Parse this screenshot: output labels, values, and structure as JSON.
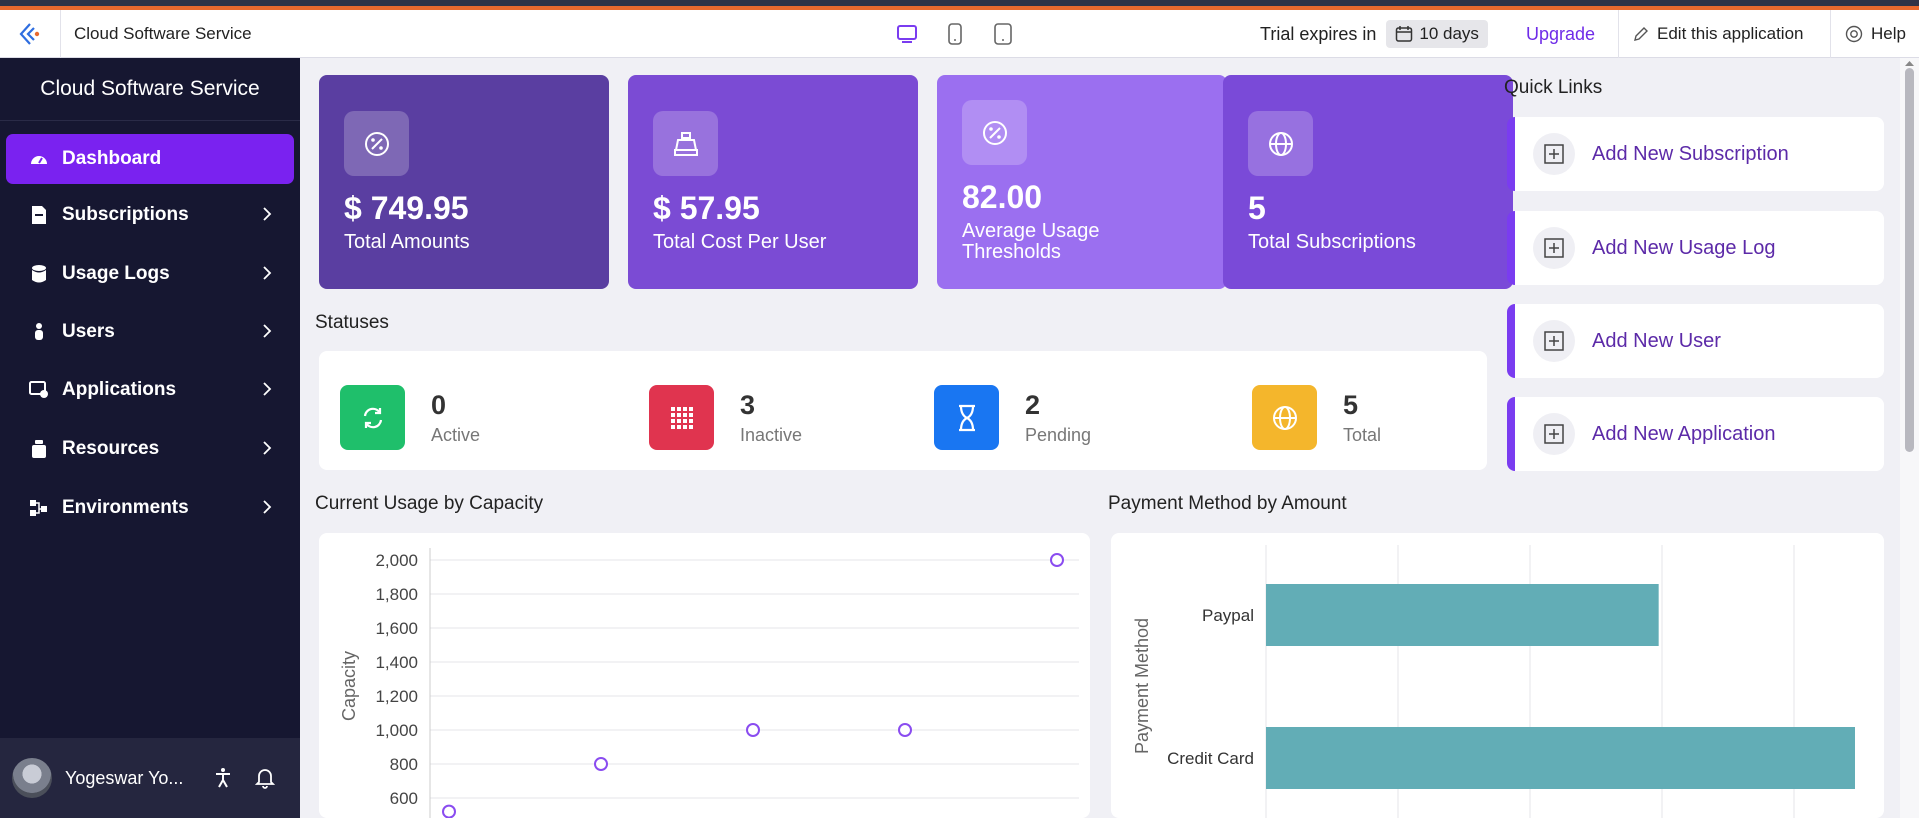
{
  "topbar": {
    "app_title": "Cloud Software Service",
    "trial_label": "Trial expires in",
    "trial_days": "10 days",
    "upgrade": "Upgrade",
    "edit": "Edit this application",
    "help": "Help"
  },
  "sidebar": {
    "title": "Cloud Software Service",
    "items": [
      {
        "label": "Dashboard",
        "icon": "dashboard-icon"
      },
      {
        "label": "Subscriptions",
        "icon": "document-icon"
      },
      {
        "label": "Usage Logs",
        "icon": "database-icon"
      },
      {
        "label": "Users",
        "icon": "user-icon"
      },
      {
        "label": "Applications",
        "icon": "app-icon"
      },
      {
        "label": "Resources",
        "icon": "resource-icon"
      },
      {
        "label": "Environments",
        "icon": "environment-icon"
      }
    ],
    "user_name": "Yogeswar Yo..."
  },
  "kpis": [
    {
      "value": "$ 749.95",
      "label": "Total Amounts",
      "color": "#5a3ea1"
    },
    {
      "value": "$ 57.95",
      "label": "Total Cost Per User",
      "color": "#7b4bd4"
    },
    {
      "value": "82.00",
      "label": "Average Usage Thresholds",
      "color": "#9b6ff0"
    },
    {
      "value": "5",
      "label": "Total Subscriptions",
      "color": "#7a4ad8"
    }
  ],
  "statuses": {
    "title": "Statuses",
    "items": [
      {
        "value": "0",
        "label": "Active",
        "color": "#1fbf6b"
      },
      {
        "value": "3",
        "label": "Inactive",
        "color": "#e0344f"
      },
      {
        "value": "2",
        "label": "Pending",
        "color": "#1976f2"
      },
      {
        "value": "5",
        "label": "Total",
        "color": "#f4b62c"
      }
    ]
  },
  "quick_links": {
    "title": "Quick Links",
    "items": [
      "Add New Subscription",
      "Add New Usage Log",
      "Add New User",
      "Add New Application"
    ]
  },
  "charts": {
    "usage_title": "Current Usage by Capacity",
    "payment_title": "Payment Method by Amount"
  },
  "chart_data": [
    {
      "type": "scatter",
      "title": "Current Usage by Capacity",
      "ylabel": "Capacity",
      "yticks": [
        "2,000",
        "1,800",
        "1,600",
        "1,400",
        "1,200",
        "1,000",
        "800",
        "600"
      ],
      "ylim": [
        600,
        2000
      ],
      "values": [
        520,
        800,
        1000,
        1000,
        2000
      ],
      "color": "#8a4cf0"
    },
    {
      "type": "bar",
      "title": "Payment Method by Amount",
      "ylabel": "Payment Method",
      "categories": [
        "Paypal",
        "Credit Card"
      ],
      "values": [
        300,
        450
      ],
      "xlim": [
        0,
        450
      ],
      "color": "#62adb6"
    }
  ]
}
